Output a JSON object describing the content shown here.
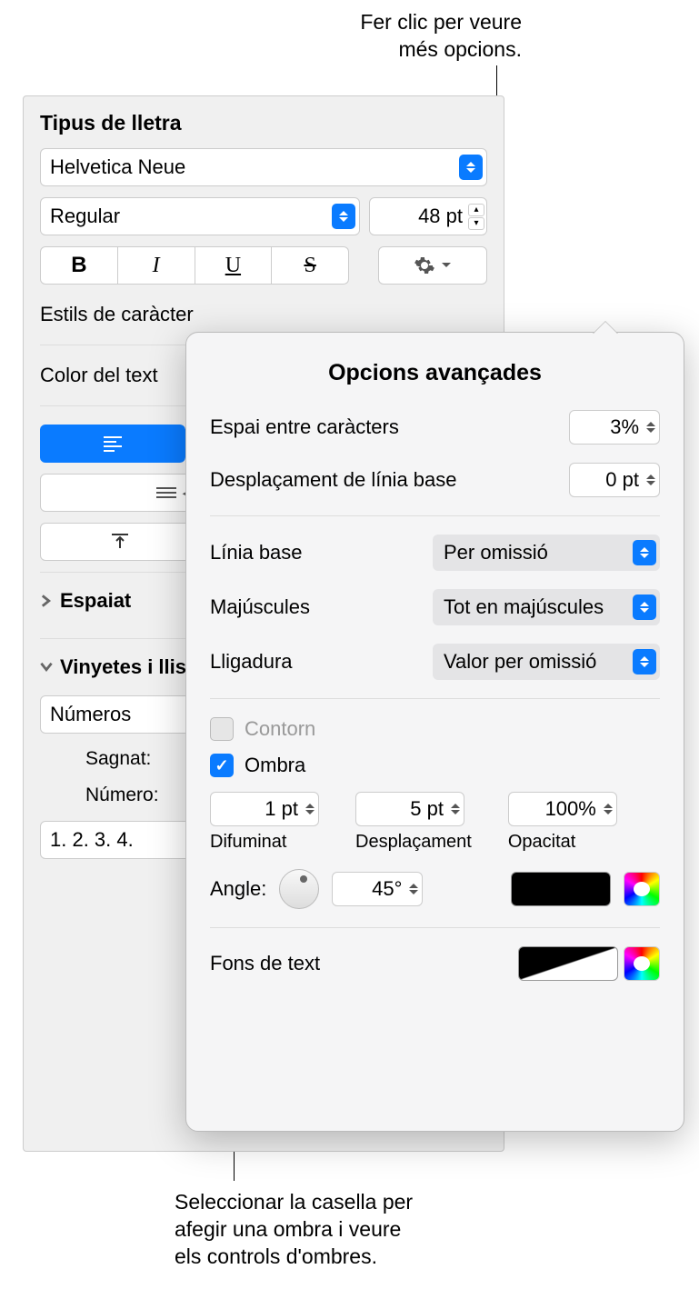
{
  "callouts": {
    "top": "Fer clic per veure\nmés opcions.",
    "bottom": "Seleccionar la casella per\nafegir una ombra i veure\nels controls d'ombres."
  },
  "panel": {
    "font_section_title": "Tipus de lletra",
    "font_family": "Helvetica Neue",
    "font_style": "Regular",
    "font_size": "48 pt",
    "char_styles_label": "Estils de caràcter",
    "text_color_label": "Color del text",
    "spacing_label": "Espaiat",
    "bullets_label": "Vinyetes i llistes",
    "bullets_type": "Números",
    "indent_label": "Sagnat:",
    "number_label": "Número:",
    "number_format": "1. 2. 3. 4."
  },
  "popover": {
    "title": "Opcions avançades",
    "char_spacing_label": "Espai entre caràcters",
    "char_spacing_value": "3%",
    "baseline_shift_label": "Desplaçament de línia base",
    "baseline_shift_value": "0 pt",
    "baseline_label": "Línia base",
    "baseline_value": "Per omissió",
    "caps_label": "Majúscules",
    "caps_value": "Tot en majúscules",
    "ligature_label": "Lligadura",
    "ligature_value": "Valor per omissió",
    "outline_label": "Contorn",
    "shadow_label": "Ombra",
    "blur_value": "1 pt",
    "blur_label": "Difuminat",
    "offset_value": "5 pt",
    "offset_label": "Desplaçament",
    "opacity_value": "100%",
    "opacity_label": "Opacitat",
    "angle_label": "Angle:",
    "angle_value": "45°",
    "text_bg_label": "Fons de text"
  }
}
